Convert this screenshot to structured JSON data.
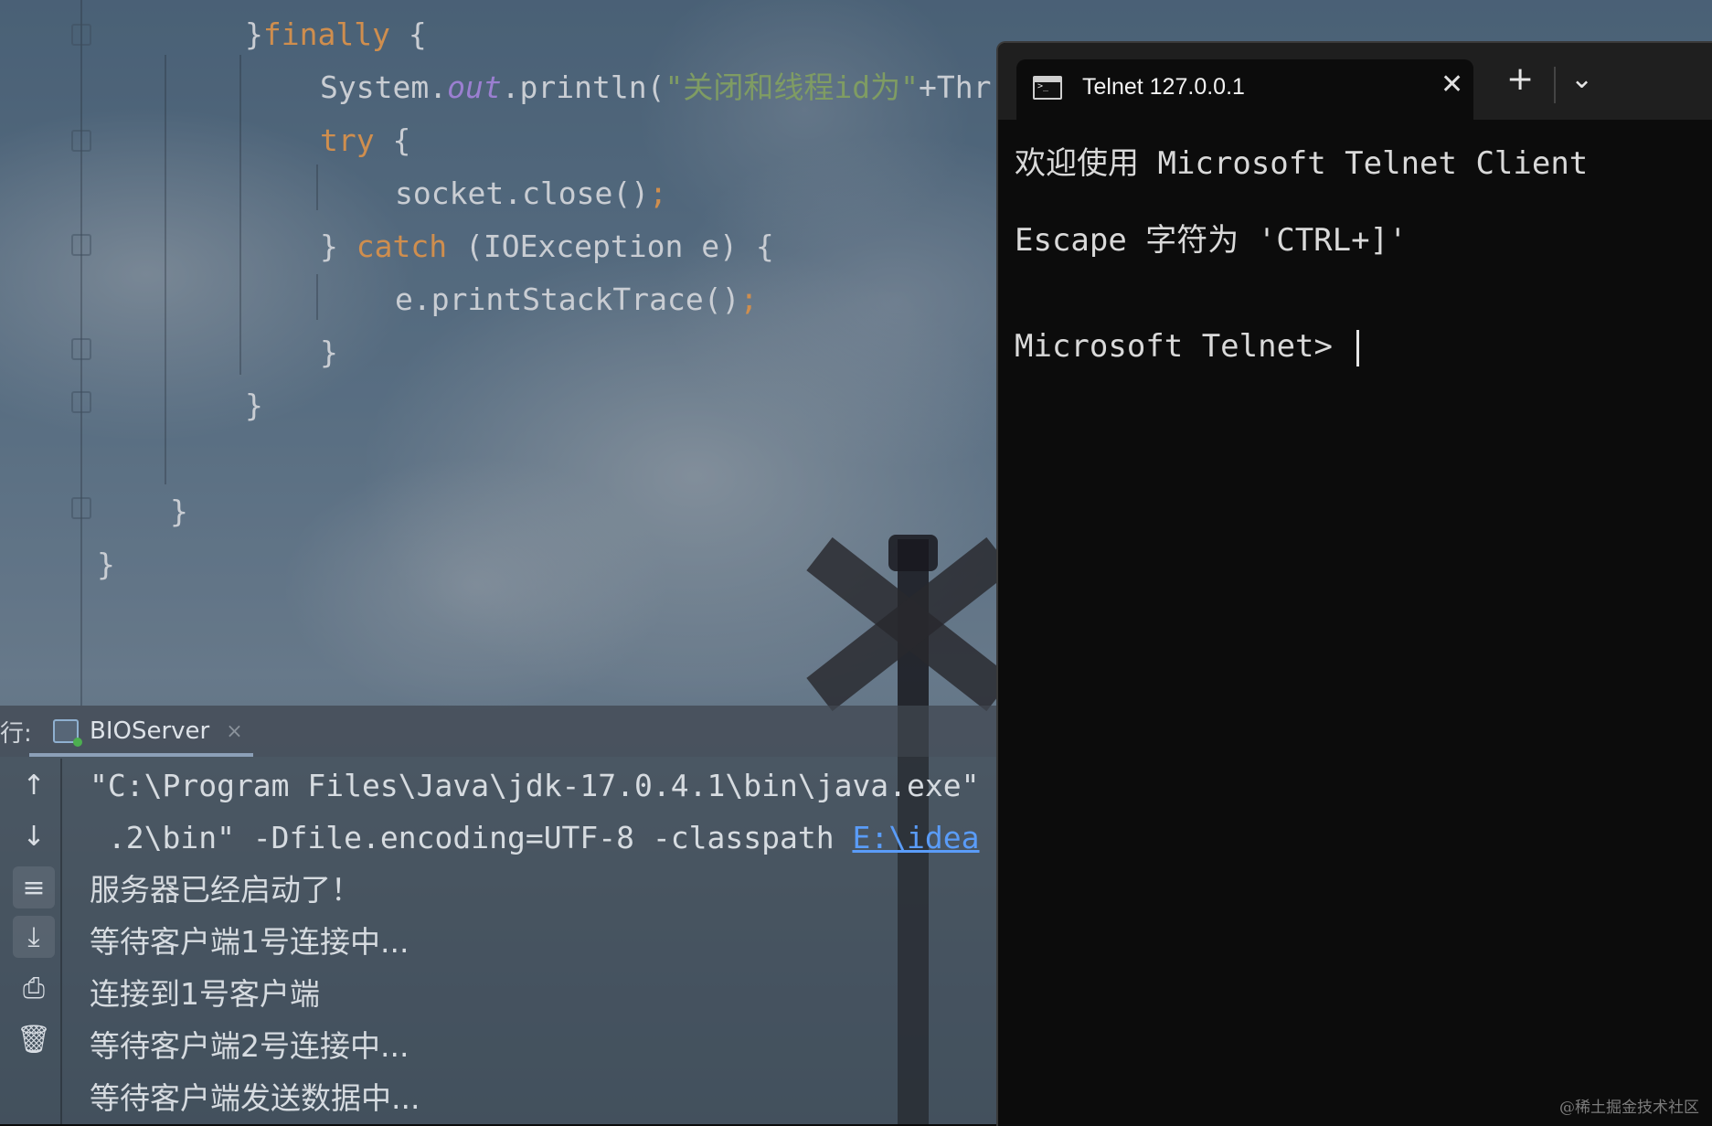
{
  "editor": {
    "lines": [
      {
        "parts": [
          {
            "t": "}",
            "c": ""
          },
          {
            "t": "finally",
            "c": "kw"
          },
          {
            "t": " {",
            "c": ""
          }
        ]
      },
      {
        "parts": [
          {
            "t": "System.",
            "c": ""
          },
          {
            "t": "out",
            "c": "fld"
          },
          {
            "t": ".println(",
            "c": ""
          },
          {
            "t": "\"关闭和线程id为\"",
            "c": "str"
          },
          {
            "t": "+Thr",
            "c": ""
          }
        ]
      },
      {
        "parts": [
          {
            "t": "try",
            "c": "kw"
          },
          {
            "t": " {",
            "c": ""
          }
        ]
      },
      {
        "parts": [
          {
            "t": "socket.close()",
            "c": ""
          },
          {
            "t": ";",
            "c": "semi"
          }
        ]
      },
      {
        "parts": [
          {
            "t": "} ",
            "c": ""
          },
          {
            "t": "catch",
            "c": "kw"
          },
          {
            "t": " (IOException e) {",
            "c": ""
          }
        ]
      },
      {
        "parts": [
          {
            "t": "e.printStackTrace()",
            "c": ""
          },
          {
            "t": ";",
            "c": "semi"
          }
        ]
      },
      {
        "parts": [
          {
            "t": "}",
            "c": ""
          }
        ]
      },
      {
        "parts": [
          {
            "t": "}",
            "c": ""
          }
        ]
      },
      {
        "parts": [
          {
            "t": "}",
            "c": ""
          }
        ]
      },
      {
        "parts": [
          {
            "t": "}",
            "c": ""
          }
        ]
      }
    ]
  },
  "run_panel": {
    "prefix": "行:",
    "tab_label": "BIOServer",
    "tab_close": "×",
    "gutter_icons": [
      "arrow-up-icon",
      "arrow-down-icon",
      "soft-wrap-icon",
      "scroll-to-end-icon",
      "print-icon",
      "trash-icon"
    ],
    "output": [
      {
        "text": "\"C:\\Program Files\\Java\\jdk-17.0.4.1\\bin\\java.exe\"",
        "mono": true
      },
      {
        "text": " .2\\bin\" -Dfile.encoding=UTF-8 -classpath ",
        "mono": true,
        "link": "E:\\idea"
      },
      {
        "text": "服务器已经启动了！"
      },
      {
        "text": "等待客户端1号连接中..."
      },
      {
        "text": "连接到1号客户端"
      },
      {
        "text": "等待客户端2号连接中..."
      },
      {
        "text": "等待客户端发送数据中..."
      }
    ]
  },
  "terminal": {
    "tab_title": "Telnet 127.0.0.1",
    "close_glyph": "✕",
    "new_tab_glyph": "+",
    "dropdown_glyph": "⌄",
    "lines": [
      "欢迎使用 Microsoft Telnet Client",
      "Escape 字符为 'CTRL+]'",
      "Microsoft Telnet> "
    ],
    "colors": {
      "background": "#0c0c0c",
      "text": "#d9d9d9",
      "tabbar": "#1f1f1f"
    }
  },
  "watermark": "@稀土掘金技术社区"
}
